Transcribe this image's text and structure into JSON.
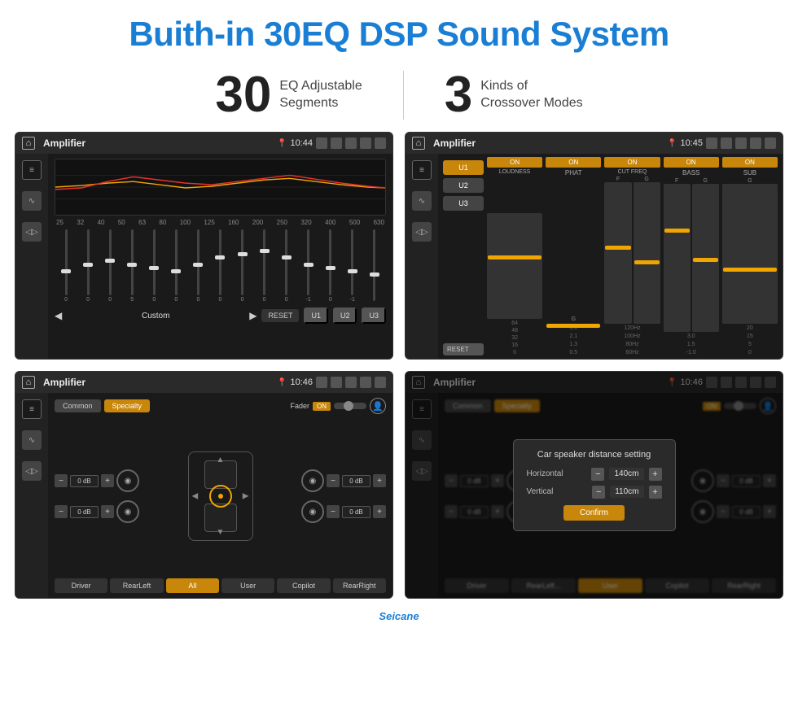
{
  "header": {
    "title": "Buith-in 30EQ DSP Sound System"
  },
  "stats": [
    {
      "number": "30",
      "text_line1": "EQ Adjustable",
      "text_line2": "Segments"
    },
    {
      "number": "3",
      "text_line1": "Kinds of",
      "text_line2": "Crossover Modes"
    }
  ],
  "screens": [
    {
      "id": "screen1",
      "topbar": {
        "title": "Amplifier",
        "time": "10:44"
      },
      "type": "equalizer",
      "eq_labels": [
        "25",
        "32",
        "40",
        "50",
        "63",
        "80",
        "100",
        "125",
        "160",
        "200",
        "250",
        "320",
        "400",
        "500",
        "630"
      ],
      "bottom_buttons": [
        "RESET",
        "U1",
        "U2",
        "U3"
      ],
      "mode_label": "Custom"
    },
    {
      "id": "screen2",
      "topbar": {
        "title": "Amplifier",
        "time": "10:45"
      },
      "type": "crossover",
      "channels": [
        {
          "on": true,
          "name": "LOUDNESS"
        },
        {
          "on": true,
          "name": "PHAT"
        },
        {
          "on": true,
          "name": "CUT FREQ"
        },
        {
          "on": true,
          "name": "BASS"
        },
        {
          "on": true,
          "name": "SUB"
        }
      ],
      "presets": [
        "U1",
        "U2",
        "U3"
      ],
      "reset_label": "RESET"
    },
    {
      "id": "screen3",
      "topbar": {
        "title": "Amplifier",
        "time": "10:46"
      },
      "type": "speaker",
      "tabs": [
        "Common",
        "Specialty"
      ],
      "active_tab": "Specialty",
      "fader_label": "Fader",
      "on_label": "ON",
      "channels": [
        {
          "label": "0 dB"
        },
        {
          "label": "0 dB"
        },
        {
          "label": "0 dB"
        },
        {
          "label": "0 dB"
        }
      ],
      "bottom_buttons": [
        {
          "label": "Driver",
          "active": false
        },
        {
          "label": "RearLeft",
          "active": false
        },
        {
          "label": "All",
          "active": true
        },
        {
          "label": "User",
          "active": false
        },
        {
          "label": "Copilot",
          "active": false
        },
        {
          "label": "RearRight",
          "active": false
        }
      ]
    },
    {
      "id": "screen4",
      "topbar": {
        "title": "Amplifier",
        "time": "10:46"
      },
      "type": "speaker_dialog",
      "tabs": [
        "Common",
        "Specialty"
      ],
      "active_tab": "Specialty",
      "dialog": {
        "title": "Car speaker distance setting",
        "horizontal_label": "Horizontal",
        "horizontal_value": "140cm",
        "vertical_label": "Vertical",
        "vertical_value": "110cm",
        "confirm_label": "Confirm"
      },
      "bottom_buttons": [
        {
          "label": "Driver",
          "active": false
        },
        {
          "label": "RearLeft",
          "active": false
        },
        {
          "label": "Copilot",
          "active": false
        },
        {
          "label": "RearRight",
          "active": false
        }
      ]
    }
  ],
  "watermark": "Seicane"
}
